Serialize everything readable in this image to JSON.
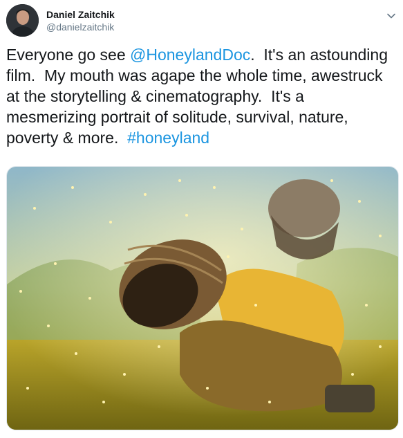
{
  "author": {
    "display_name": "Daniel Zaitchik",
    "handle": "@danielzaitchik",
    "avatar_icon": "person-avatar"
  },
  "tweet": {
    "text_before": "Everyone go see ",
    "mention": "@HoneylandDoc",
    "text_middle": ".  It's an astounding film.  My mouth was agape the whole time, awestruck at the storytelling & cinematography.  It's a mesmerizing portrait of solitude, survival, nature, poverty & more.  ",
    "hashtag": "#honeyland"
  },
  "media": {
    "icon": "photo"
  },
  "colors": {
    "link": "#1b95e0",
    "secondary_text": "#657786"
  }
}
